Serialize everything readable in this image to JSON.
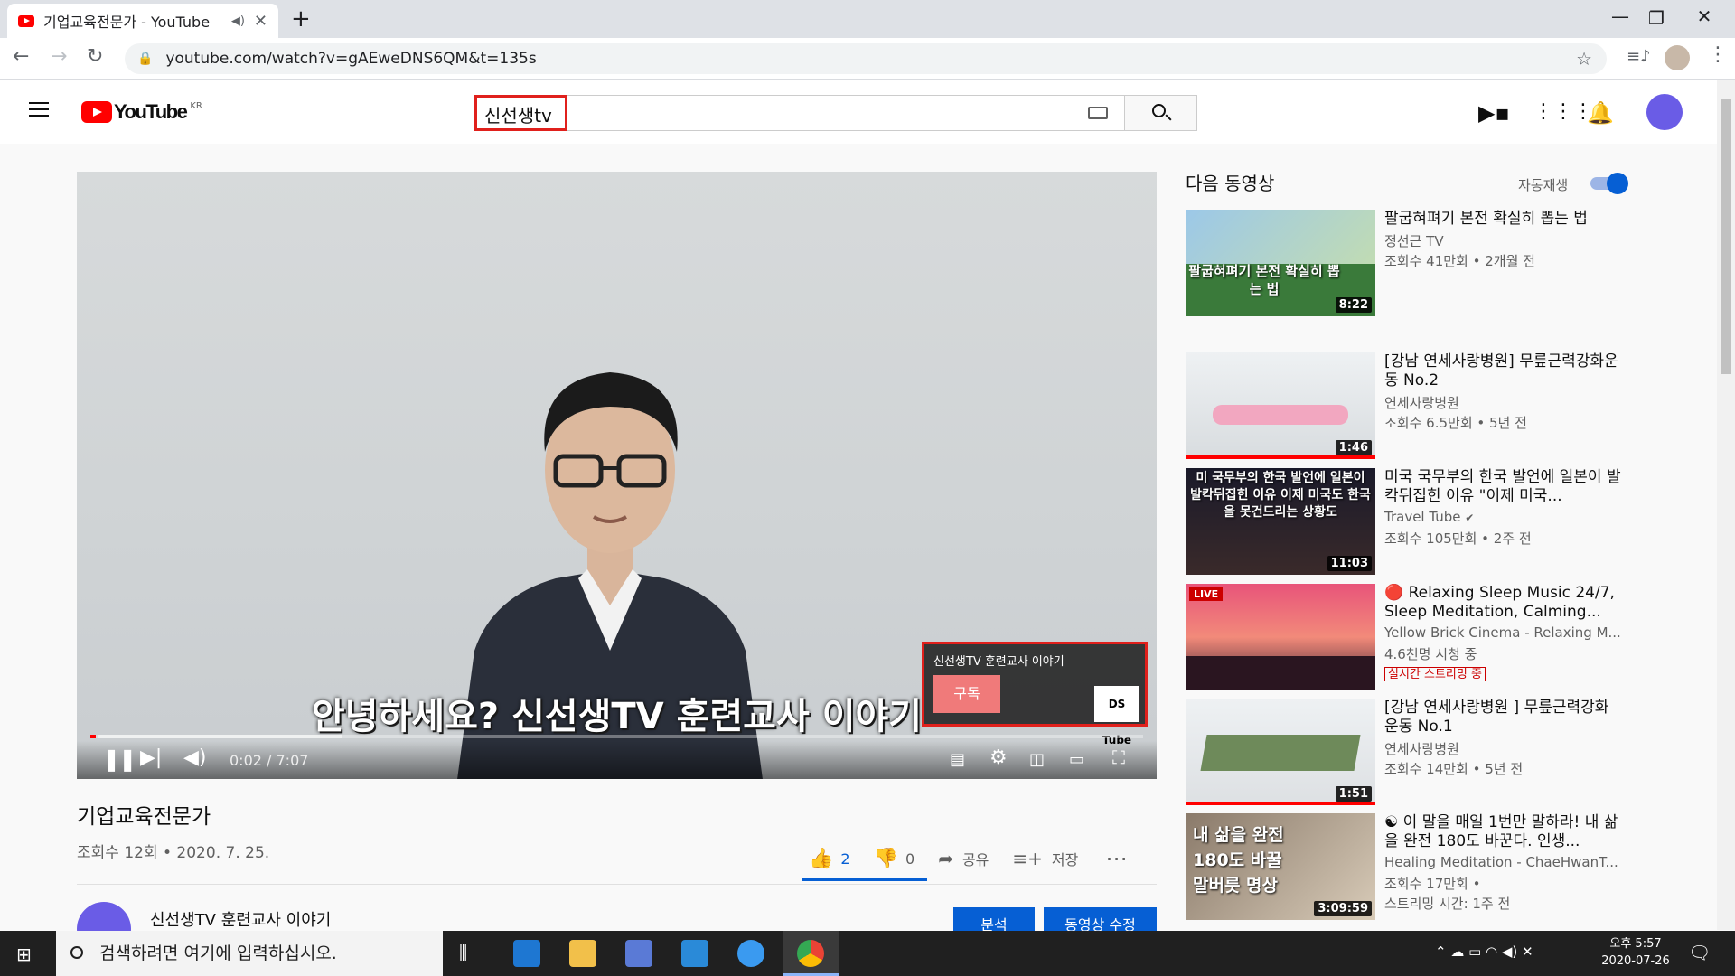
{
  "browser": {
    "tab_title": "기업교육전문가 - YouTube",
    "tab_close": "✕",
    "new_tab": "+",
    "url": "youtube.com/watch?v=gAEweDNS6QM&t=135s"
  },
  "youtube": {
    "logo_text": "YouTube",
    "region": "KR",
    "search_query": "신선생tv"
  },
  "player": {
    "subtitle": "안녕하세요? 신선생TV 훈련교사 이야기",
    "time": "0:02 / 7:07",
    "progress_fraction": 0.005,
    "branding_channel": "신선생TV 훈련교사 이야기",
    "branding_subscribe": "구독",
    "branding_logo": "DS Tube"
  },
  "video": {
    "title": "기업교육전문가",
    "meta": "조회수 12회 • 2020. 7. 25.",
    "likes": "2",
    "dislikes": "0",
    "share_label": "공유",
    "save_label": "저장",
    "channel_name": "신선생TV 훈련교사 이야기",
    "btn_analytics": "분석",
    "btn_edit": "동영상 수정"
  },
  "sidebar": {
    "up_next": "다음 동영상",
    "autoplay": "자동재생",
    "items": [
      {
        "title": "팔굽혀펴기 본전 확실히 뽑는 법",
        "channel": "정선근 TV",
        "meta": "조회수 41만회 • 2개월 전",
        "duration": "8:22",
        "thumb_text": "팔굽혀펴기 본전 확실히 뽑는 법"
      },
      {
        "title": "[강남 연세사랑병원] 무릎근력강화운동 No.2",
        "channel": "연세사랑병원",
        "meta": "조회수 6.5만회 • 5년 전",
        "duration": "1:46"
      },
      {
        "title": "미국 국무부의 한국 발언에 일본이 발칵뒤집힌 이유 \"이제 미국...",
        "channel": "Travel Tube",
        "meta": "조회수 105만회 • 2주 전",
        "duration": "11:03",
        "thumb_text": "미 국무부의 한국 발언에 일본이 발칵뒤집힌 이유 이제 미국도 한국을 못건드리는 상황도"
      },
      {
        "title": "🔴 Relaxing Sleep Music 24/7, Sleep Meditation, Calming...",
        "channel": "Yellow Brick Cinema - Relaxing M...",
        "meta": "4.6천명 시청 중",
        "tag": "실시간 스트리밍 중",
        "live": "LIVE"
      },
      {
        "title": "[강남 연세사랑병원 ] 무릎근력강화운동 No.1",
        "channel": "연세사랑병원",
        "meta": "조회수 14만회 • 5년 전",
        "duration": "1:51"
      },
      {
        "title": "☯ 이 말을 매일 1번만 말하라! 내 삶을 완전 180도 바꾼다. 인생...",
        "channel": "Healing Meditation - ChaeHwanT...",
        "meta": "조회수 17만회 •",
        "meta2": "스트리밍 시간: 1주 전",
        "duration": "3:09:59",
        "thumb_text": "내 삶을 완전 180도 바꿀 말버릇 명상"
      }
    ]
  },
  "taskbar": {
    "search_placeholder": "검색하려면 여기에 입력하십시오.",
    "time": "오후 5:57",
    "date": "2020-07-26"
  },
  "colors": {
    "yt_red": "#ff0000",
    "accent_blue": "#065fd4",
    "highlight_box": "#e0201c"
  }
}
